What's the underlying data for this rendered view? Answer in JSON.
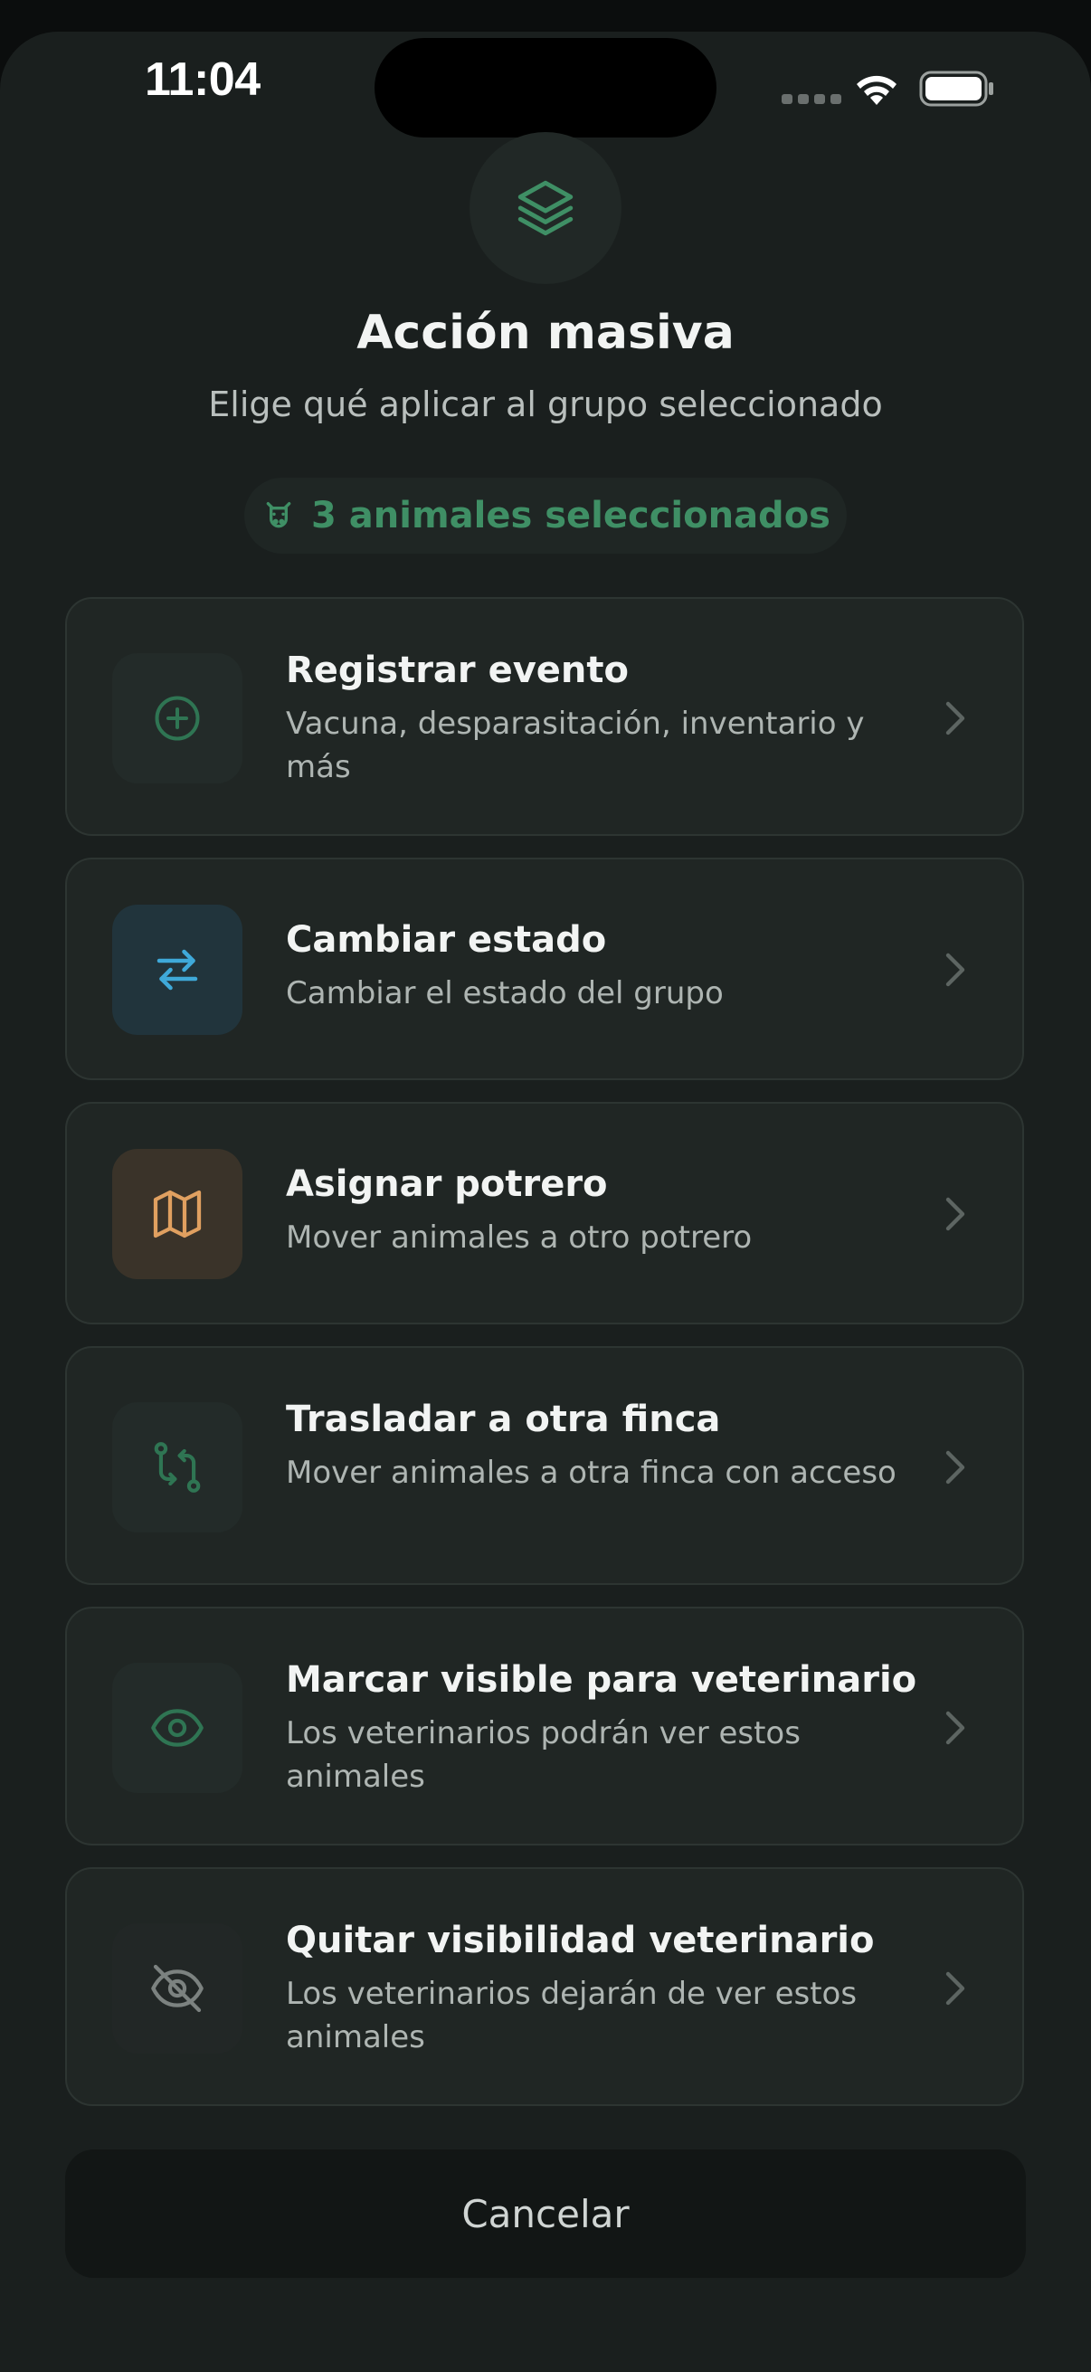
{
  "status_bar": {
    "time": "11:04"
  },
  "header": {
    "title": "Acción masiva",
    "subtitle": "Elige qué aplicar al grupo seleccionado",
    "selection_badge": "3 animales seleccionados"
  },
  "actions": [
    {
      "label": "Registrar evento",
      "description": "Vacuna, desparasitación, inventario y más",
      "icon": "plus-circle-icon"
    },
    {
      "label": "Cambiar estado",
      "description": "Cambiar el estado del grupo",
      "icon": "swap-arrows-icon"
    },
    {
      "label": "Asignar potrero",
      "description": "Mover animales a otro potrero",
      "icon": "map-icon"
    },
    {
      "label": "Trasladar a otra finca",
      "description": "Mover animales a otra finca con acceso",
      "icon": "transfer-icon"
    },
    {
      "label": "Marcar visible para veterinario",
      "description": "Los veterinarios podrán ver estos animales",
      "icon": "eye-icon"
    },
    {
      "label": "Quitar visibilidad veterinario",
      "description": "Los veterinarios dejarán de ver estos animales",
      "icon": "eye-off-icon"
    }
  ],
  "cancel_label": "Cancelar",
  "colors": {
    "background": "#1a1f1e",
    "accent_green": "#3f8f65",
    "accent_blue": "#3fa9d9",
    "accent_orange": "#e0a060",
    "card": "#202624"
  }
}
